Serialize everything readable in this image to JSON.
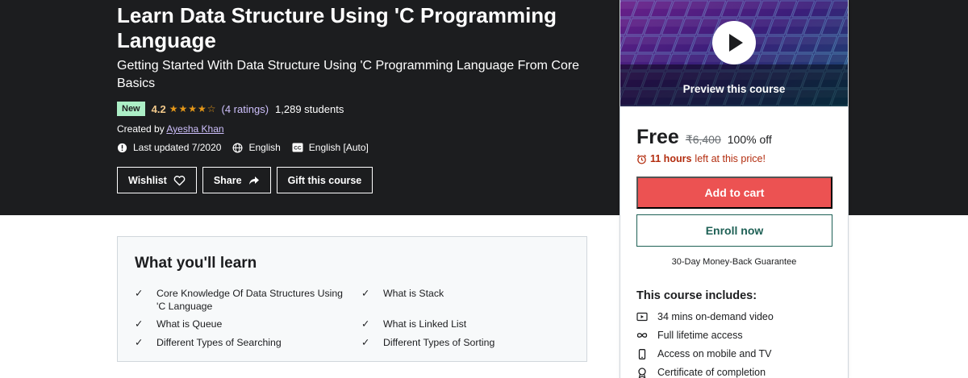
{
  "course": {
    "title": "Learn Data Structure Using 'C Programming Language",
    "subtitle": "Getting Started With Data Structure Using 'C Programming Language From Core Basics",
    "badge": "New",
    "rating": "4.2",
    "rating_value": 4.2,
    "stars": "★★★★☆",
    "ratings_count": "(4 ratings)",
    "students": "1,289 students",
    "created_by_label": "Created by",
    "instructor": "Ayesha Khan",
    "last_updated": "Last updated 7/2020",
    "language": "English",
    "captions": "English [Auto]"
  },
  "actions": {
    "wishlist": "Wishlist",
    "share": "Share",
    "gift": "Gift this course"
  },
  "learn": {
    "title": "What you'll learn",
    "items": [
      "Core Knowledge Of Data Structures Using 'C Language",
      "What is Stack",
      "What is Queue",
      "What is Linked List",
      "Different Types of Searching",
      "Different Types of Sorting"
    ]
  },
  "sidebar": {
    "preview_label": "Preview this course",
    "price": "Free",
    "original_price": "₹6,400",
    "discount": "100% off",
    "timer_bold": "11 hours",
    "timer_text": "left at this price!",
    "cart": "Add to cart",
    "enroll": "Enroll now",
    "guarantee": "30-Day Money-Back Guarantee",
    "includes_title": "This course includes:",
    "includes": [
      {
        "icon": "video-icon",
        "label": "34 mins on-demand video"
      },
      {
        "icon": "infinity-icon",
        "label": "Full lifetime access"
      },
      {
        "icon": "mobile-icon",
        "label": "Access on mobile and TV"
      },
      {
        "icon": "certificate-icon",
        "label": "Certificate of completion"
      }
    ]
  },
  "colors": {
    "hero_bg": "#1c1d1f",
    "badge_bg": "#aceec6",
    "rating": "#f3ca8c",
    "link": "#cec0fc",
    "cart": "#ec5252",
    "enroll": "#1e6055",
    "timer": "#b32d0f"
  }
}
